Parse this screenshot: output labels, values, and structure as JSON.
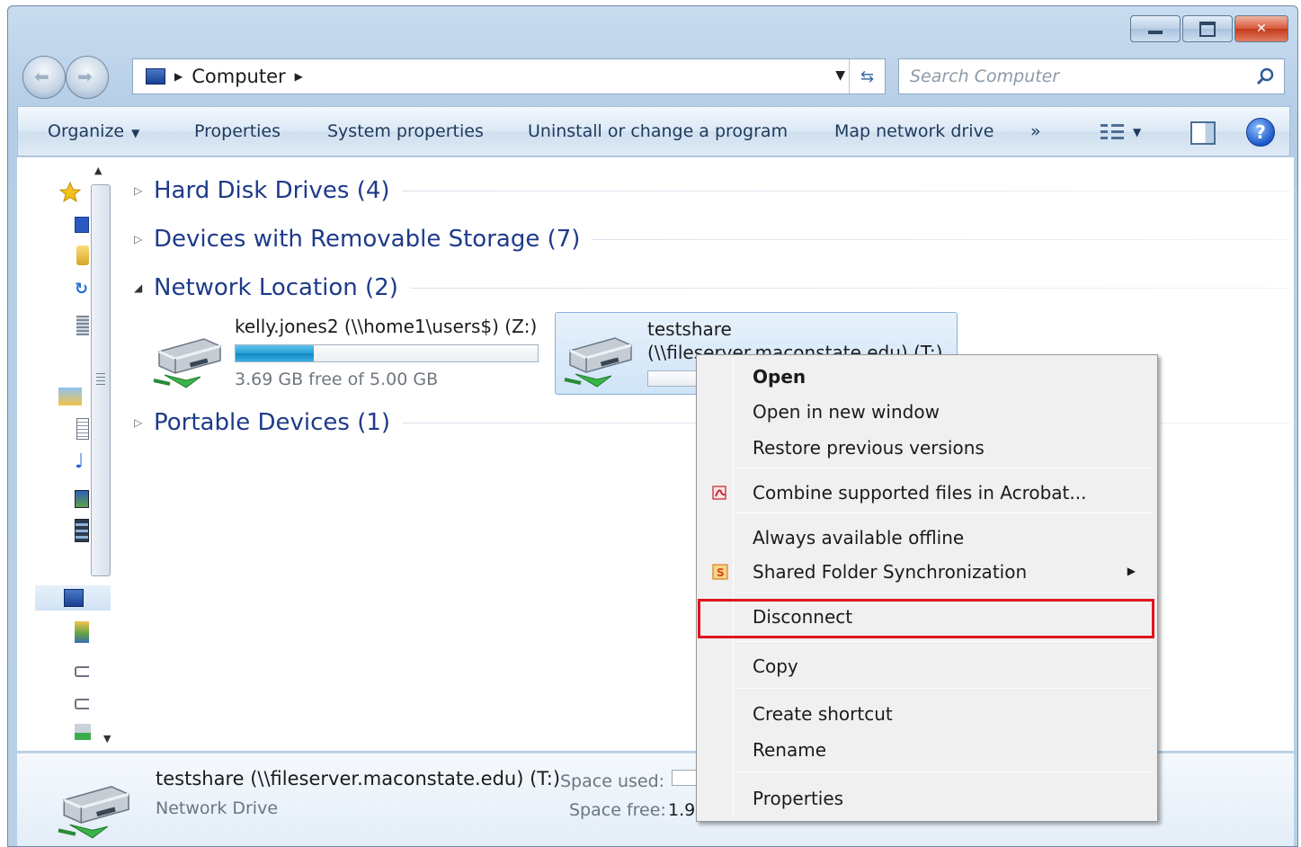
{
  "window": {
    "caption_buttons": [
      "minimize",
      "maximize",
      "close"
    ]
  },
  "address_bar": {
    "location": "Computer",
    "search_placeholder": "Search Computer"
  },
  "command_bar": {
    "items": [
      {
        "label": "Organize",
        "has_dropdown": true
      },
      {
        "label": "Properties"
      },
      {
        "label": "System properties"
      },
      {
        "label": "Uninstall or change a program"
      },
      {
        "label": "Map network drive"
      },
      {
        "label": "»"
      }
    ]
  },
  "groups": [
    {
      "label": "Hard Disk Drives (4)",
      "expanded": false
    },
    {
      "label": "Devices with Removable Storage (7)",
      "expanded": false
    },
    {
      "label": "Network Location (2)",
      "expanded": true
    },
    {
      "label": "Portable Devices (1)",
      "expanded": false
    }
  ],
  "drives": [
    {
      "name": "kelly.jones2 (\\\\home1\\users$) (Z:)",
      "free_text": "3.69 GB free of 5.00 GB",
      "used_fraction": 0.26,
      "selected": false
    },
    {
      "name_line1": "testshare",
      "name_line2": "(\\\\fileserver.maconstate.edu) (T:)",
      "selected": true
    }
  ],
  "context_menu": {
    "items": [
      {
        "label": "Open",
        "bold": true
      },
      {
        "label": "Open in new window"
      },
      {
        "label": "Restore previous versions"
      },
      {
        "label": "Combine supported files in Acrobat...",
        "icon": "acrobat-icon"
      },
      {
        "label": "Always available offline"
      },
      {
        "label": "Shared Folder Synchronization",
        "icon": "sync-icon",
        "submenu": true
      },
      {
        "label": "Disconnect",
        "highlighted": true
      },
      {
        "label": "Copy"
      },
      {
        "label": "Create shortcut"
      },
      {
        "label": "Rename"
      },
      {
        "label": "Properties"
      }
    ]
  },
  "details_pane": {
    "name": "testshare (\\\\fileserver.maconstate.edu) (T:)",
    "type": "Network Drive",
    "space_used_label": "Space used:",
    "space_free_label": "Space free:",
    "space_free_value": "1.99"
  },
  "colors": {
    "highlight_border": "#e0141e",
    "group_header": "#1e3a8a",
    "bar_fill": "#27a0d6"
  }
}
